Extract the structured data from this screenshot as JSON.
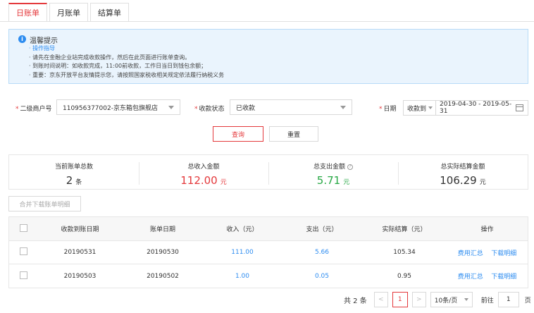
{
  "tabs": [
    {
      "label": "日账单",
      "active": true
    },
    {
      "label": "月账单",
      "active": false
    },
    {
      "label": "结算单",
      "active": false
    }
  ],
  "notice": {
    "title": "温馨提示",
    "lines": [
      "· 操作指导",
      "· 请先在金融企业站完成收款操作，然后在此页面进行账单查询。",
      "· 到账时间说明：如收款完成，11:00前收款，工作日当日到钱包余额；",
      "· 重要：京东开放平台友情提示您，请按照国家税收相关规定依法履行纳税义务"
    ]
  },
  "filters": {
    "merchant_label": "二级商户号",
    "merchant_value": "110956377002-京东箱包旗舰店",
    "status_label": "收款状态",
    "status_value": "已收款",
    "date_label": "日期",
    "date_type": "收款到",
    "date_range": "2019-04-30  -  2019-05-31"
  },
  "actions": {
    "search": "查询",
    "reset": "重置",
    "merge_download": "合并下载账单明细"
  },
  "summary": [
    {
      "label": "当前账单总数",
      "value": "2",
      "unit": "条",
      "color": "#333333"
    },
    {
      "label": "总收入金额",
      "value": "112.00",
      "unit": "元",
      "color": "#e4393c"
    },
    {
      "label": "总支出金额",
      "value": "5.71",
      "unit": "元",
      "color": "#27a844"
    },
    {
      "label": "总实际结算金额",
      "value": "106.29",
      "unit": "元",
      "color": "#333333"
    }
  ],
  "table": {
    "headers": [
      "收款到账日期",
      "账单日期",
      "收入（元）",
      "支出（元）",
      "实际结算（元）",
      "操作"
    ],
    "rows": [
      {
        "pay_date": "20190531",
        "bill_date": "20190530",
        "income": "111.00",
        "expense": "5.66",
        "settle": "105.34",
        "op1": "费用汇总",
        "op2": "下载明细"
      },
      {
        "pay_date": "20190503",
        "bill_date": "20190502",
        "income": "1.00",
        "expense": "0.05",
        "settle": "0.95",
        "op1": "费用汇总",
        "op2": "下载明细"
      }
    ]
  },
  "pagination": {
    "total": "共 2 条",
    "prev": "<",
    "current": "1",
    "next": ">",
    "page_size": "10条/页",
    "goto_label": "前往",
    "goto_value": "1",
    "goto_unit": "页"
  },
  "colors": {
    "accent": "#e4393c",
    "link": "#2d8cf0",
    "income_positive": "#e4393c",
    "expense": "#27a844"
  }
}
